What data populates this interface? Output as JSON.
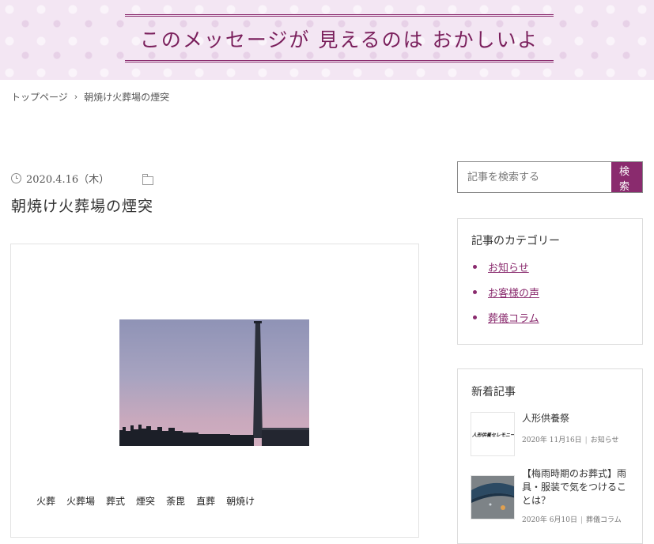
{
  "header": {
    "banner_title": "このメッセージが 見えるのは おかしいよ"
  },
  "breadcrumb": {
    "home": "トップページ",
    "separator": "›",
    "current": "朝焼け火葬場の煙突"
  },
  "post": {
    "date": "2020.4.16（木）",
    "title": "朝焼け火葬場の煙突",
    "tags": [
      "火葬",
      "火葬場",
      "葬式",
      "煙突",
      "荼毘",
      "直葬",
      "朝焼け"
    ]
  },
  "search": {
    "placeholder": "記事を検索する",
    "button_label": "検 索"
  },
  "categories_widget": {
    "title": "記事のカテゴリー",
    "items": [
      "お知らせ",
      "お客様の声",
      "葬儀コラム"
    ]
  },
  "recent_widget": {
    "title": "新着記事",
    "items": [
      {
        "title": "人形供養祭",
        "date": "2020年 11月16日",
        "category": "お知らせ",
        "thumb_text": "人形供養セレモニー"
      },
      {
        "title": "【梅雨時期のお葬式】雨具・服装で気をつけることは？",
        "date": "2020年 6月10日",
        "category": "葬儀コラム"
      }
    ]
  },
  "colors": {
    "accent": "#8a2b6e",
    "header_bg": "#f3e6f3"
  }
}
